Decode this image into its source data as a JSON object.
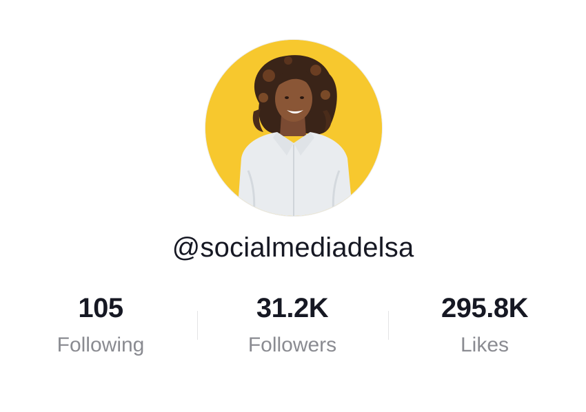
{
  "profile": {
    "username": "@socialmediadelsa",
    "avatar_background": "#f7c82e",
    "stats": {
      "following": {
        "value": "105",
        "label": "Following"
      },
      "followers": {
        "value": "31.2K",
        "label": "Followers"
      },
      "likes": {
        "value": "295.8K",
        "label": "Likes"
      }
    }
  },
  "colors": {
    "text_primary": "#161823",
    "text_secondary": "#8a8b91",
    "divider": "#e3e3e4"
  }
}
